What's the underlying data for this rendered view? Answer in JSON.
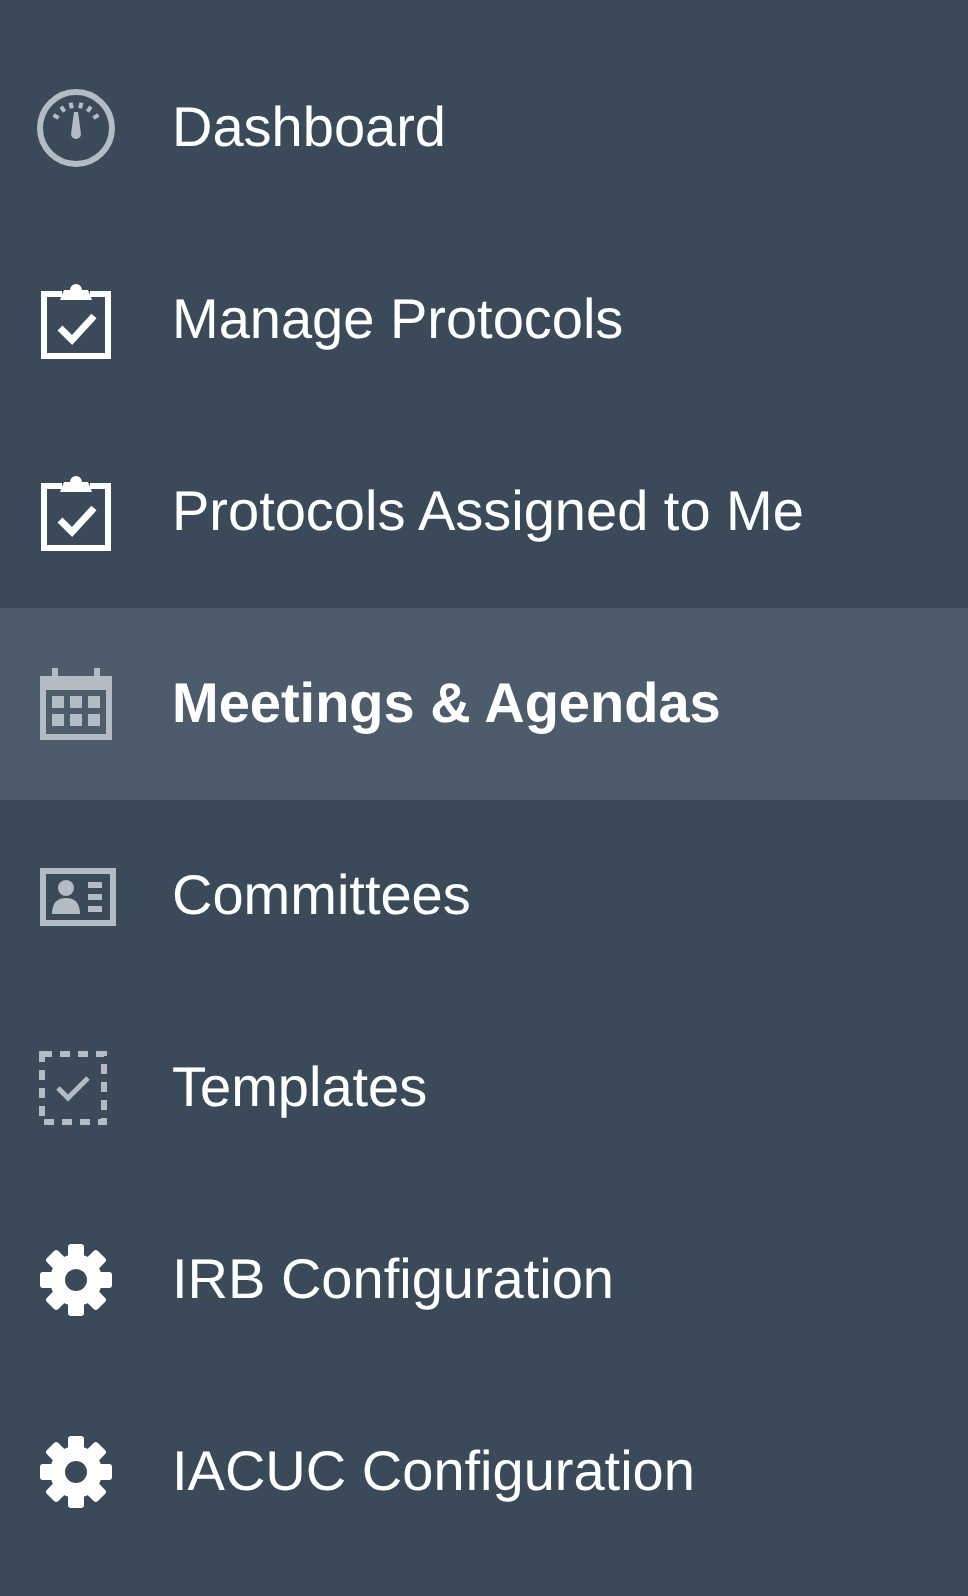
{
  "nav_items": [
    {
      "label": "Dashboard",
      "kind": "gauge",
      "selected": false
    },
    {
      "label": "Manage Protocols",
      "kind": "clipboard",
      "selected": false
    },
    {
      "label": "Protocols Assigned to Me",
      "kind": "clipboard",
      "selected": false
    },
    {
      "label": "Meetings & Agendas",
      "kind": "calendar",
      "selected": true
    },
    {
      "label": "Committees",
      "kind": "idcard",
      "selected": false
    },
    {
      "label": "Templates",
      "kind": "template",
      "selected": false
    },
    {
      "label": "IRB Configuration",
      "kind": "gear",
      "selected": false
    },
    {
      "label": "IACUC Configuration",
      "kind": "gear",
      "selected": false
    }
  ]
}
